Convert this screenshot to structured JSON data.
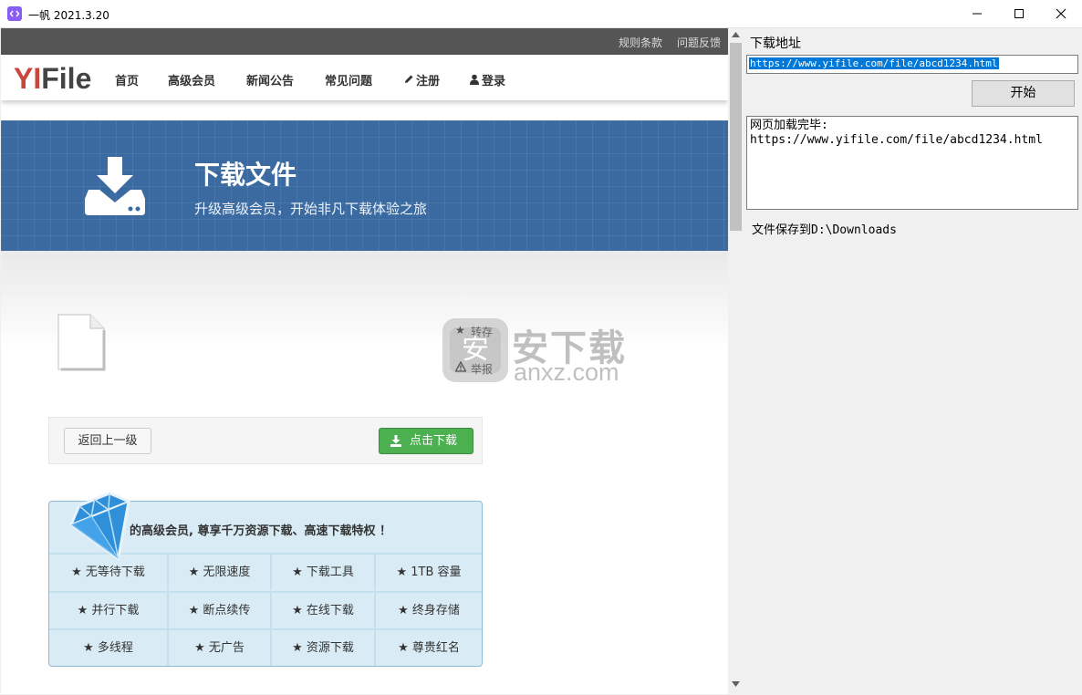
{
  "window": {
    "title": "一帆 2021.3.20",
    "app_icon": "app-logo-icon",
    "controls": [
      "minimize-icon",
      "maximize-icon",
      "close-icon"
    ]
  },
  "site": {
    "top_links": [
      "规则条款",
      "问题反馈"
    ],
    "logo": {
      "yi": "YI",
      "file": "File"
    },
    "nav": [
      {
        "label": "首页",
        "icon": ""
      },
      {
        "label": "高级会员",
        "icon": ""
      },
      {
        "label": "新闻公告",
        "icon": ""
      },
      {
        "label": "常见问题",
        "icon": ""
      },
      {
        "label": "注册",
        "icon": "pencil-icon"
      },
      {
        "label": "登录",
        "icon": "user-icon"
      }
    ],
    "hero": {
      "title": "下载文件",
      "subtitle": "升级高级会员，开始非凡下载体验之旅",
      "icon": "download-drive-icon"
    },
    "file_icon": "file-icon",
    "side_actions": [
      {
        "label": "转存",
        "icon": "star-icon"
      },
      {
        "label": "举报",
        "icon": "warning-icon"
      }
    ],
    "watermark": {
      "cn": "安下载",
      "en": "anxz.com",
      "logo_char": "安"
    },
    "back_button": "返回上一级",
    "download_button": "点击下载",
    "vip": {
      "headline": "的高级会员, 尊享千万资源下载、高速下载特权 ！",
      "star": "★",
      "features": [
        [
          "无等待下载",
          "无限速度",
          "下载工具",
          "1TB 容量"
        ],
        [
          "并行下载",
          "断点续传",
          "在线下载",
          "终身存储"
        ],
        [
          "多线程",
          "无广告",
          "资源下载",
          "尊贵红名"
        ]
      ]
    }
  },
  "panel": {
    "address_label": "下载地址",
    "url_value": "https://www.yifile.com/file/abcd1234.html",
    "start_button": "开始",
    "log": "网页加载完毕:\nhttps://www.yifile.com/file/abcd1234.html",
    "save_path": "文件保存到D:\\Downloads"
  }
}
